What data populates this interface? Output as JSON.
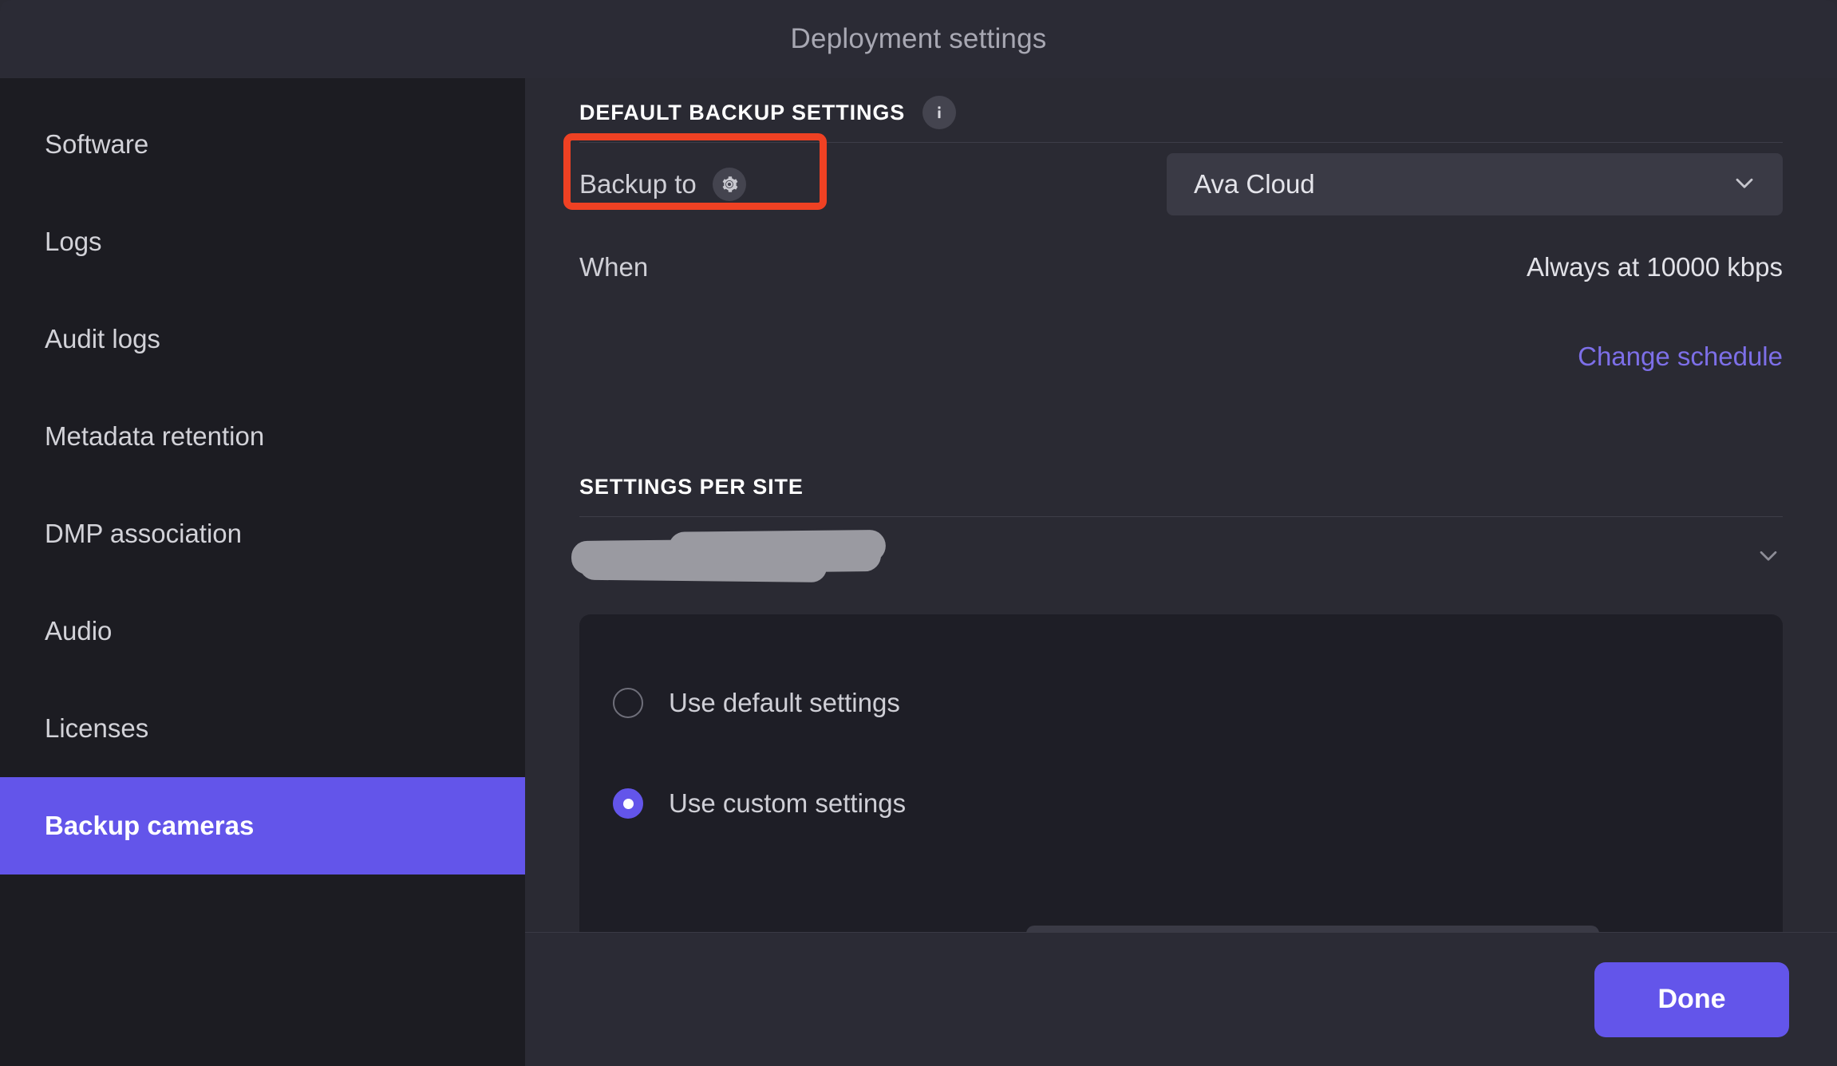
{
  "window": {
    "title": "Deployment settings"
  },
  "sidebar": {
    "items": [
      {
        "label": "Software",
        "active": false
      },
      {
        "label": "Logs",
        "active": false
      },
      {
        "label": "Audit logs",
        "active": false
      },
      {
        "label": "Metadata retention",
        "active": false
      },
      {
        "label": "DMP association",
        "active": false
      },
      {
        "label": "Audio",
        "active": false
      },
      {
        "label": "Licenses",
        "active": false
      },
      {
        "label": "Backup cameras",
        "active": true
      }
    ]
  },
  "main": {
    "default_backup": {
      "section_title": "DEFAULT BACKUP SETTINGS",
      "info_icon": "info-icon",
      "backup_to_label": "Backup to",
      "backup_to_gear_icon": "gear-icon",
      "backup_to_value": "Ava Cloud",
      "dropdown_icon": "chevron-down-icon",
      "when_label": "When",
      "when_value": "Always at 10000 kbps",
      "change_schedule_link": "Change schedule"
    },
    "settings_per_site": {
      "section_title": "SETTINGS PER SITE",
      "site_name": "",
      "site_chevron_icon": "chevron-down-icon",
      "options": [
        {
          "label": "Use default settings",
          "selected": false
        },
        {
          "label": "Use custom settings",
          "selected": true
        }
      ]
    }
  },
  "footer": {
    "done_label": "Done"
  },
  "colors": {
    "accent": "#6355ea",
    "link": "#7d6fe8",
    "highlight": "#ef4123",
    "panel_bg": "#2a2a33",
    "sidebar_bg": "#1c1c22",
    "card_bg": "#1e1e26",
    "field_bg": "#3a3a45"
  }
}
